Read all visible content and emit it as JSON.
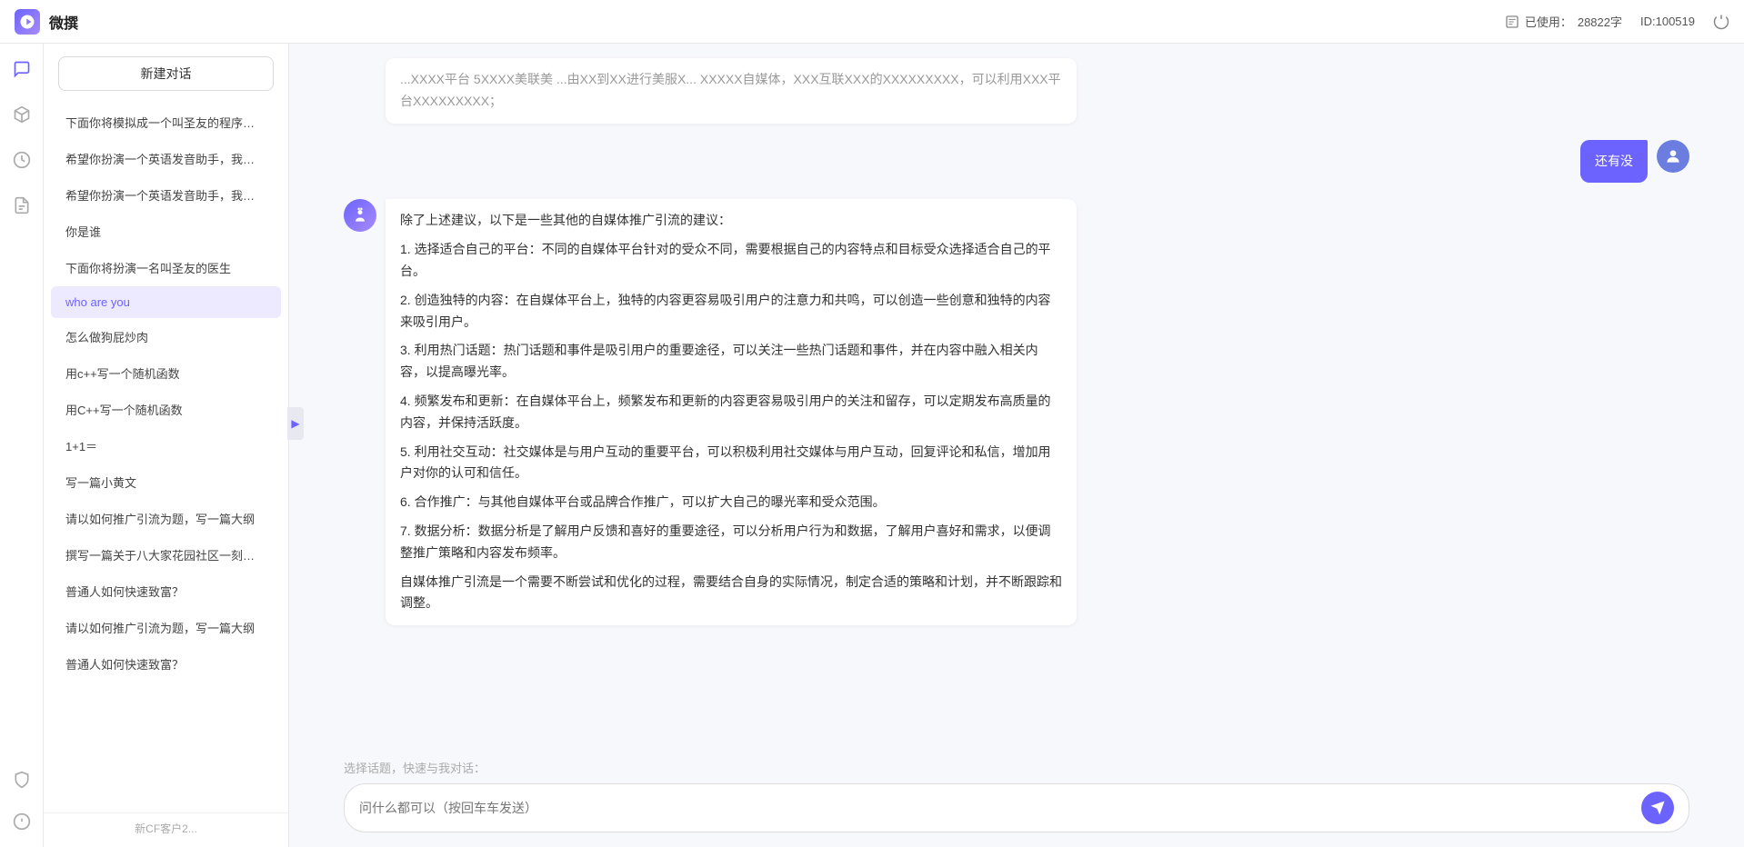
{
  "header": {
    "logo": "W",
    "title": "微撰",
    "usage_label": "已使用：",
    "usage_count": "28822字",
    "id_label": "ID:100519",
    "power_icon": "⏻"
  },
  "sidebar": {
    "new_btn_label": "新建对话",
    "items": [
      {
        "id": 1,
        "text": "下面你将模拟成一个叫圣友的程序员，我说..."
      },
      {
        "id": 2,
        "text": "希望你扮演一个英语发音助手，我提供给你..."
      },
      {
        "id": 3,
        "text": "希望你扮演一个英语发音助手，我提供给你..."
      },
      {
        "id": 4,
        "text": "你是谁"
      },
      {
        "id": 5,
        "text": "下面你将扮演一名叫圣友的医生"
      },
      {
        "id": 6,
        "text": "who are you",
        "active": true
      },
      {
        "id": 7,
        "text": "怎么做狗屁炒肉"
      },
      {
        "id": 8,
        "text": "用c++写一个随机函数"
      },
      {
        "id": 9,
        "text": "用C++写一个随机函数"
      },
      {
        "id": 10,
        "text": "1+1＝"
      },
      {
        "id": 11,
        "text": "写一篇小黄文"
      },
      {
        "id": 12,
        "text": "请以如何推广引流为题，写一篇大纲"
      },
      {
        "id": 13,
        "text": "撰写一篇关于八大家花园社区一刻钟便民生..."
      },
      {
        "id": 14,
        "text": "普通人如何快速致富？"
      },
      {
        "id": 15,
        "text": "请以如何推广引流为题，写一篇大纲"
      },
      {
        "id": 16,
        "text": "普通人如何快速致富？"
      }
    ],
    "bottom_text": "新CF客户2..."
  },
  "icons": {
    "cube": "⬡",
    "clock": "⏱",
    "doc": "📄",
    "shield": "🛡",
    "info": "ℹ",
    "collapse": "▶"
  },
  "chat": {
    "partial_text": "...XXXX平台 5XXXX美联美 ...由XX到XX进行美服X... XXXXX自媒体，XXX互联XXX的XXXXXXXXX，可以利用XXX平台XXXXXXXXX；",
    "messages": [
      {
        "id": 1,
        "role": "user",
        "avatar_type": "user",
        "text": "还有没"
      },
      {
        "id": 2,
        "role": "ai",
        "avatar_type": "ai",
        "paragraphs": [
          "除了上述建议，以下是一些其他的自媒体推广引流的建议：",
          "1. 选择适合自己的平台：不同的自媒体平台针对的受众不同，需要根据自己的内容特点和目标受众选择适合自己的平台。",
          "2. 创造独特的内容：在自媒体平台上，独特的内容更容易吸引用户的注意力和共鸣，可以创造一些创意和独特的内容来吸引用户。",
          "3. 利用热门话题：热门话题和事件是吸引用户的重要途径，可以关注一些热门话题和事件，并在内容中融入相关内容，以提高曝光率。",
          "4. 频繁发布和更新：在自媒体平台上，频繁发布和更新的内容更容易吸引用户的关注和留存，可以定期发布高质量的内容，并保持活跃度。",
          "5. 利用社交互动：社交媒体是与用户互动的重要平台，可以积极利用社交媒体与用户互动，回复评论和私信，增加用户对你的认可和信任。",
          "6. 合作推广：与其他自媒体平台或品牌合作推广，可以扩大自己的曝光率和受众范围。",
          "7. 数据分析：数据分析是了解用户反馈和喜好的重要途径，可以分析用户行为和数据，了解用户喜好和需求，以便调整推广策略和内容发布频率。",
          "自媒体推广引流是一个需要不断尝试和优化的过程，需要结合自身的实际情况，制定合适的策略和计划，并不断跟踪和调整。"
        ]
      }
    ],
    "quick_topics_label": "选择话题，快速与我对话：",
    "input_placeholder": "问什么都可以（按回车车发送）",
    "send_icon": "send"
  }
}
